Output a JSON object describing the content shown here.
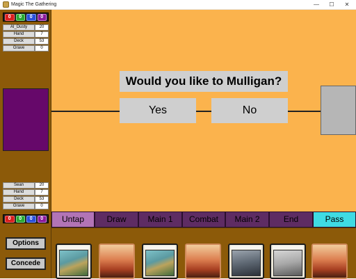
{
  "window": {
    "title": "Magic The Gathering",
    "min": "—",
    "max": "☐",
    "close": "✕"
  },
  "colors": {
    "panel_brown": "#8c5a09",
    "board_orange": "#fbb34d",
    "phase_purple": "#5e2c63",
    "phase_active": "#b274b6",
    "pass_cyan": "#3fdbe3",
    "opponent_portrait": "#66086a"
  },
  "mana_values": [
    "0",
    "0",
    "0",
    "0"
  ],
  "mana_colors": [
    "#d91e1e",
    "#2aa834",
    "#2a4fd9",
    "#8a1a9a"
  ],
  "opponent": {
    "stats": [
      {
        "label": "AI_Dusty",
        "value": "20"
      },
      {
        "label": "Hand",
        "value": "7"
      },
      {
        "label": "Deck",
        "value": "53"
      },
      {
        "label": "Grave",
        "value": "0"
      }
    ]
  },
  "player": {
    "stats": [
      {
        "label": "Sean",
        "value": "20"
      },
      {
        "label": "Hand",
        "value": "7"
      },
      {
        "label": "Deck",
        "value": "53"
      },
      {
        "label": "Grave",
        "value": "0"
      }
    ]
  },
  "controls": {
    "options": "Options",
    "concede": "Concede"
  },
  "prompt": {
    "question": "Would you like to Mulligan?",
    "yes": "Yes",
    "no": "No"
  },
  "phases": [
    {
      "label": "Untap",
      "state": "active"
    },
    {
      "label": "Draw",
      "state": "normal"
    },
    {
      "label": "Main 1",
      "state": "normal"
    },
    {
      "label": "Combat",
      "state": "normal"
    },
    {
      "label": "Main 2",
      "state": "normal"
    },
    {
      "label": "End",
      "state": "normal"
    },
    {
      "label": "Pass",
      "state": "pass"
    }
  ],
  "hand": [
    {
      "kind": "creature",
      "art": "bird"
    },
    {
      "kind": "land",
      "art": "plains"
    },
    {
      "kind": "creature",
      "art": "bird"
    },
    {
      "kind": "land",
      "art": "plains"
    },
    {
      "kind": "creature",
      "art": "dark"
    },
    {
      "kind": "creature",
      "art": "pale"
    },
    {
      "kind": "land",
      "art": "plains"
    }
  ]
}
